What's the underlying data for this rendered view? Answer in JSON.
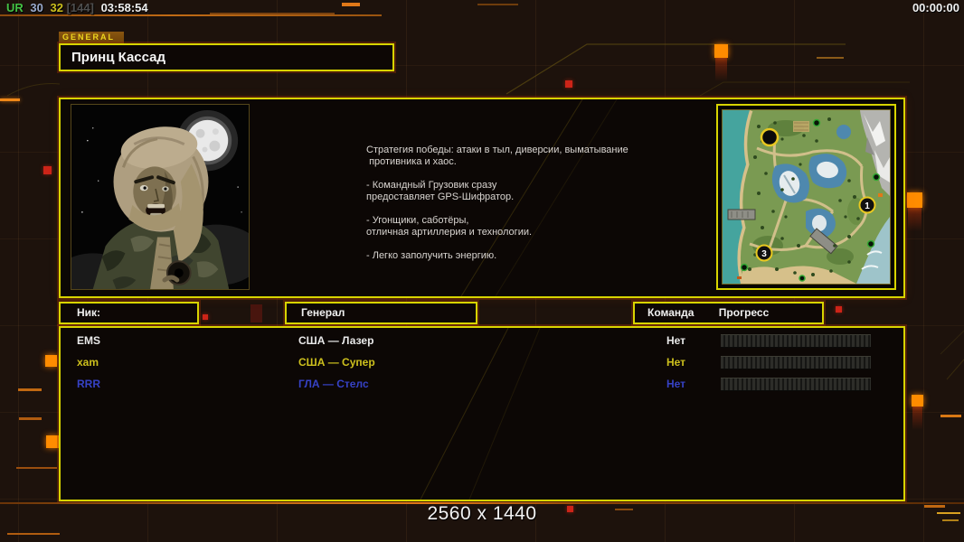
{
  "status_bar": {
    "parts": [
      {
        "text": "UR",
        "color": "#44c244"
      },
      {
        "text": "30",
        "color": "#9aaacd"
      },
      {
        "text": "32",
        "color": "#cdc01d"
      },
      {
        "text": "[144]",
        "color": "#4f4f4f"
      },
      {
        "text": "03:58:54",
        "color": "#f0f0f0"
      }
    ],
    "match_timer": "00:00:00"
  },
  "general_panel": {
    "tab_label": "GENERAL",
    "general_name": "Принц Кассад",
    "strategy_text": "Стратегия победы: атаки в тыл, диверсии, выматывание\n противника и хаос.\n\n- Командный Грузовик сразу\nпредоставляет GPS-Шифратор.\n\n- Угонщики, саботёры,\nотличная артиллерия и технологии.\n\n- Легко заполучить энергию."
  },
  "map_preview": {
    "start_position_labels": [
      "1",
      "3"
    ]
  },
  "players_table": {
    "headers": {
      "nick": "Ник:",
      "general": "Генерал",
      "team": "Команда",
      "progress": "Прогресс"
    },
    "rows": [
      {
        "nick": "EMS",
        "general": "США — Лазер",
        "team": "Нет",
        "color": "#e9e9e9",
        "progress_percent": 0
      },
      {
        "nick": "xam",
        "general": "США — Супер",
        "team": "Нет",
        "color": "#cdc01d",
        "progress_percent": 0
      },
      {
        "nick": "RRR",
        "general": "ГЛА — Стелс",
        "team": "Нет",
        "color": "#3642c6",
        "progress_percent": 0
      }
    ]
  },
  "footer": {
    "resolution": "2560 x 1440"
  },
  "colors": {
    "accent_yellow": "#d8d400",
    "accent_orange": "#ff8c00",
    "accent_red": "#cc2418",
    "background": "#1d120c"
  }
}
